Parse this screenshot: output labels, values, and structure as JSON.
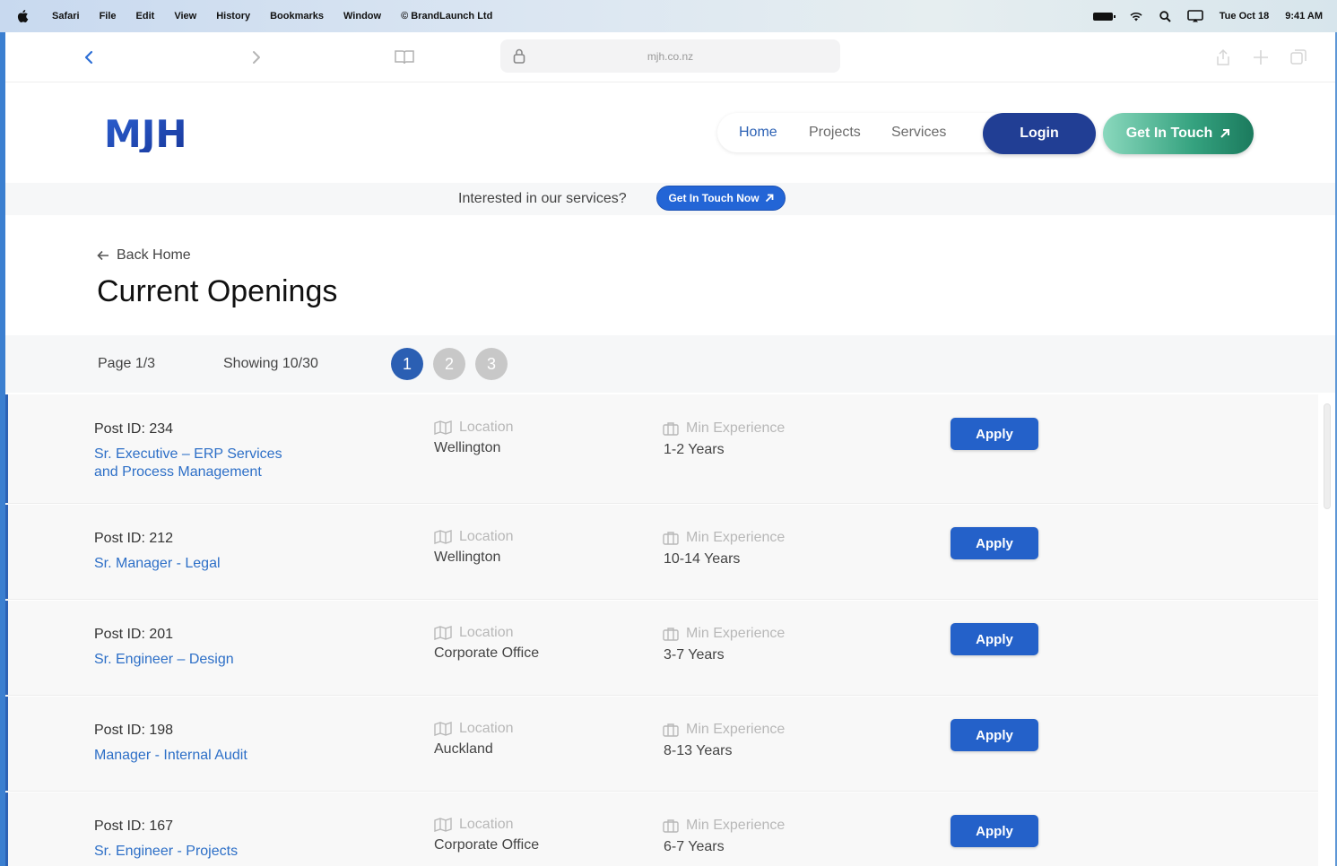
{
  "menubar": {
    "items": [
      "Safari",
      "File",
      "Edit",
      "View",
      "History",
      "Bookmarks",
      "Window",
      "© BrandLaunch Ltd"
    ],
    "date": "Tue Oct 18",
    "time": "9:41 AM"
  },
  "browser": {
    "url": "mjh.co.nz"
  },
  "header": {
    "logo": "MJH",
    "nav": [
      "Home",
      "Projects",
      "Services"
    ],
    "login_label": "Login",
    "touch_label": "Get In Touch"
  },
  "banner": {
    "text": "Interested in our services?",
    "button_label": "Get In Touch Now"
  },
  "page": {
    "back_label": "Back Home",
    "title": "Current Openings"
  },
  "pagination": {
    "page_text": "Page 1/3",
    "showing_text": "Showing 10/30",
    "pages": [
      "1",
      "2",
      "3"
    ],
    "current": "1"
  },
  "jobs": {
    "location_label": "Location",
    "experience_label": "Min Experience",
    "apply_label": "Apply",
    "items": [
      {
        "post_id": "Post ID:  234",
        "title": "Sr. Executive – ERP Services and Process Management",
        "location": "Wellington",
        "experience": "1-2 Years"
      },
      {
        "post_id": "Post ID:  212",
        "title": "Sr. Manager - Legal",
        "location": "Wellington",
        "experience": "10-14 Years"
      },
      {
        "post_id": "Post ID:  201",
        "title": "Sr. Engineer – Design",
        "location": "Corporate Office",
        "experience": "3-7 Years"
      },
      {
        "post_id": "Post ID:  198",
        "title": "Manager - Internal Audit",
        "location": "Auckland",
        "experience": "8-13 Years"
      },
      {
        "post_id": "Post ID:  167",
        "title": "Sr. Engineer - Projects",
        "location": "Corporate Office",
        "experience": "6-7 Years"
      }
    ]
  },
  "colors": {
    "primary": "#2d62b5",
    "login": "#213e94",
    "touch": "#35a27f",
    "apply": "#2461c9"
  }
}
